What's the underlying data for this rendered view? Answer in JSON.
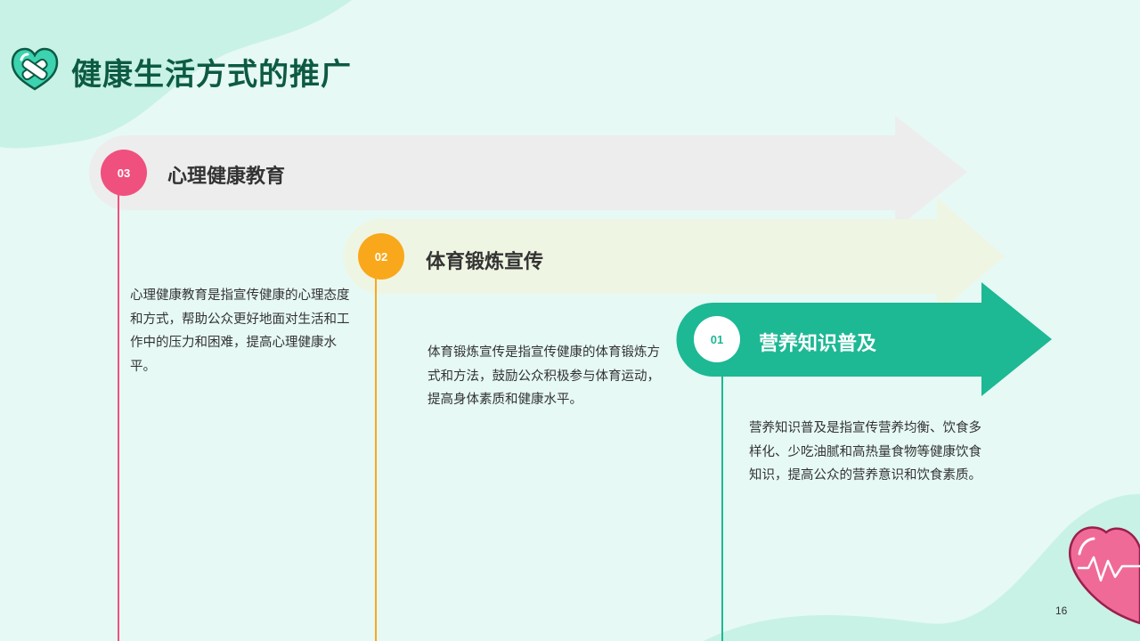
{
  "header": {
    "title": "健康生活方式的推广",
    "icon": "bandaged-heart-icon"
  },
  "items": [
    {
      "number": "03",
      "label": "心理健康教育",
      "description": "心理健康教育是指宣传健康的心理态度和方式，帮助公众更好地面对生活和工作中的压力和困难，提高心理健康水平。",
      "color": "#f0507e"
    },
    {
      "number": "02",
      "label": "体育锻炼宣传",
      "description": "体育锻炼宣传是指宣传健康的体育锻炼方式和方法，鼓励公众积极参与体育运动，提高身体素质和健康水平。",
      "color": "#f9a81b"
    },
    {
      "number": "01",
      "label": "营养知识普及",
      "description": "营养知识普及是指宣传营养均衡、饮食多样化、少吃油腻和高热量食物等健康饮食知识，提高公众的营养意识和饮食素质。",
      "color": "#1db894"
    }
  ],
  "footer": {
    "page_number": "16",
    "decoration_icon": "heart-heartbeat-icon"
  }
}
